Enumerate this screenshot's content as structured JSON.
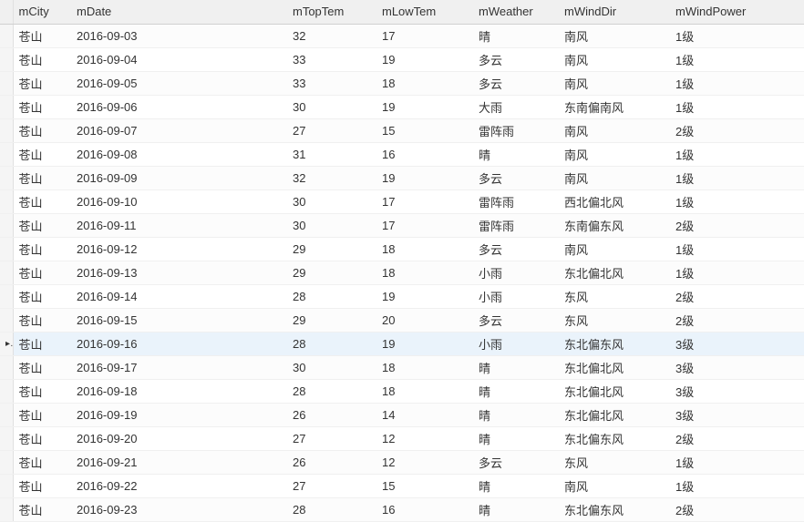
{
  "columns": {
    "selector": "",
    "city": "mCity",
    "date": "mDate",
    "toptem": "mTopTem",
    "lowtem": "mLowTem",
    "weather": "mWeather",
    "winddir": "mWindDir",
    "windpow": "mWindPower"
  },
  "selected_row_index": 13,
  "selector_marker": "▸",
  "rows": [
    {
      "city": "苍山",
      "date": "2016-09-03",
      "toptem": "32",
      "lowtem": "17",
      "weather": "晴",
      "winddir": "南风",
      "windpow": "1级"
    },
    {
      "city": "苍山",
      "date": "2016-09-04",
      "toptem": "33",
      "lowtem": "19",
      "weather": "多云",
      "winddir": "南风",
      "windpow": "1级"
    },
    {
      "city": "苍山",
      "date": "2016-09-05",
      "toptem": "33",
      "lowtem": "18",
      "weather": "多云",
      "winddir": "南风",
      "windpow": "1级"
    },
    {
      "city": "苍山",
      "date": "2016-09-06",
      "toptem": "30",
      "lowtem": "19",
      "weather": "大雨",
      "winddir": "东南偏南风",
      "windpow": "1级"
    },
    {
      "city": "苍山",
      "date": "2016-09-07",
      "toptem": "27",
      "lowtem": "15",
      "weather": "雷阵雨",
      "winddir": "南风",
      "windpow": "2级"
    },
    {
      "city": "苍山",
      "date": "2016-09-08",
      "toptem": "31",
      "lowtem": "16",
      "weather": "晴",
      "winddir": "南风",
      "windpow": "1级"
    },
    {
      "city": "苍山",
      "date": "2016-09-09",
      "toptem": "32",
      "lowtem": "19",
      "weather": "多云",
      "winddir": "南风",
      "windpow": "1级"
    },
    {
      "city": "苍山",
      "date": "2016-09-10",
      "toptem": "30",
      "lowtem": "17",
      "weather": "雷阵雨",
      "winddir": "西北偏北风",
      "windpow": "1级"
    },
    {
      "city": "苍山",
      "date": "2016-09-11",
      "toptem": "30",
      "lowtem": "17",
      "weather": "雷阵雨",
      "winddir": "东南偏东风",
      "windpow": "2级"
    },
    {
      "city": "苍山",
      "date": "2016-09-12",
      "toptem": "29",
      "lowtem": "18",
      "weather": "多云",
      "winddir": "南风",
      "windpow": "1级"
    },
    {
      "city": "苍山",
      "date": "2016-09-13",
      "toptem": "29",
      "lowtem": "18",
      "weather": "小雨",
      "winddir": "东北偏北风",
      "windpow": "1级"
    },
    {
      "city": "苍山",
      "date": "2016-09-14",
      "toptem": "28",
      "lowtem": "19",
      "weather": "小雨",
      "winddir": "东风",
      "windpow": "2级"
    },
    {
      "city": "苍山",
      "date": "2016-09-15",
      "toptem": "29",
      "lowtem": "20",
      "weather": "多云",
      "winddir": "东风",
      "windpow": "2级"
    },
    {
      "city": "苍山",
      "date": "2016-09-16",
      "toptem": "28",
      "lowtem": "19",
      "weather": "小雨",
      "winddir": "东北偏东风",
      "windpow": "3级"
    },
    {
      "city": "苍山",
      "date": "2016-09-17",
      "toptem": "30",
      "lowtem": "18",
      "weather": "晴",
      "winddir": "东北偏北风",
      "windpow": "3级"
    },
    {
      "city": "苍山",
      "date": "2016-09-18",
      "toptem": "28",
      "lowtem": "18",
      "weather": "晴",
      "winddir": "东北偏北风",
      "windpow": "3级"
    },
    {
      "city": "苍山",
      "date": "2016-09-19",
      "toptem": "26",
      "lowtem": "14",
      "weather": "晴",
      "winddir": "东北偏北风",
      "windpow": "3级"
    },
    {
      "city": "苍山",
      "date": "2016-09-20",
      "toptem": "27",
      "lowtem": "12",
      "weather": "晴",
      "winddir": "东北偏东风",
      "windpow": "2级"
    },
    {
      "city": "苍山",
      "date": "2016-09-21",
      "toptem": "26",
      "lowtem": "12",
      "weather": "多云",
      "winddir": "东风",
      "windpow": "1级"
    },
    {
      "city": "苍山",
      "date": "2016-09-22",
      "toptem": "27",
      "lowtem": "15",
      "weather": "晴",
      "winddir": "南风",
      "windpow": "1级"
    },
    {
      "city": "苍山",
      "date": "2016-09-23",
      "toptem": "28",
      "lowtem": "16",
      "weather": "晴",
      "winddir": "东北偏东风",
      "windpow": "2级"
    }
  ]
}
